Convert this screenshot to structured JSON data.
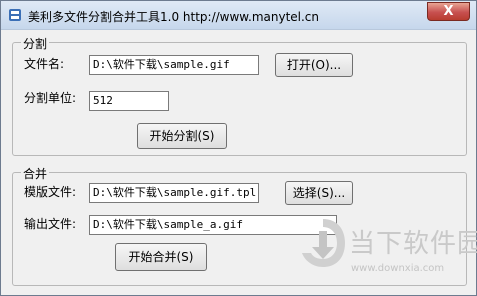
{
  "window": {
    "title": "美利多文件分割合并工具1.0 http://www.manytel.cn",
    "close_label": "X"
  },
  "split_group": {
    "legend": "分割",
    "file_label": "文件名:",
    "file_value": "D:\\软件下载\\sample.gif",
    "open_button": "打开(O)...",
    "unit_label": "分割单位:",
    "unit_value": "512",
    "start_button": "开始分割(S)"
  },
  "merge_group": {
    "legend": "合并",
    "template_label": "模版文件:",
    "template_value": "D:\\软件下载\\sample.gif.tpl",
    "select_button": "选择(S)...",
    "output_label": "输出文件:",
    "output_value": "D:\\软件下载\\sample_a.gif",
    "start_button": "开始合并(S)"
  },
  "watermark": {
    "brand_text": "当下软件园",
    "url": "www.downxia.com"
  },
  "icons": {
    "app": "app-icon",
    "close": "close-icon",
    "watermark_logo": "downxia-logo-icon"
  }
}
